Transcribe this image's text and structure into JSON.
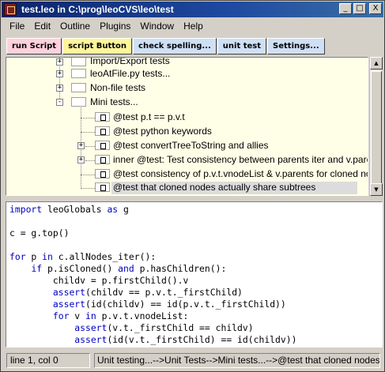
{
  "window": {
    "title": "test.leo in C:\\prog\\leoCVS\\leo\\test",
    "controls": [
      "_",
      "□",
      "X"
    ]
  },
  "menu": [
    "File",
    "Edit",
    "Outline",
    "Plugins",
    "Window",
    "Help"
  ],
  "toolbar": [
    {
      "label": "run Script",
      "color": "#ffd1dc"
    },
    {
      "label": "script Button",
      "color": "#fff59a"
    },
    {
      "label": "check spelling...",
      "color": "#cfe0f5"
    },
    {
      "label": "unit test",
      "color": "#cfe0f5"
    },
    {
      "label": "Settings...",
      "color": "#cfe0f5"
    }
  ],
  "outline": {
    "nodes": [
      {
        "label": "Import/Export tests",
        "expander": "+",
        "icon": "empty"
      },
      {
        "label": "leoAtFile.py tests...",
        "expander": "+",
        "icon": "empty"
      },
      {
        "label": "Non-file tests",
        "expander": "+",
        "icon": "empty"
      },
      {
        "label": "Mini tests...",
        "expander": "-",
        "icon": "empty"
      },
      {
        "label": "@test p.t == p.v.t",
        "expander": "",
        "icon": "dot"
      },
      {
        "label": "@test python keywords",
        "expander": "",
        "icon": "dot"
      },
      {
        "label": "@test convertTreeToString and allies",
        "expander": "+",
        "icon": "dot"
      },
      {
        "label": "inner @test: Test consistency between parents iter and v.parents",
        "expander": "+",
        "icon": "dot"
      },
      {
        "label": "@test consistency of p.v.t.vnodeList & v.parents for cloned nodes",
        "expander": "",
        "icon": "dot"
      },
      {
        "label": "@test that cloned nodes actually share subtrees",
        "expander": "",
        "icon": "dot",
        "selected": true
      }
    ]
  },
  "body": {
    "lines": [
      "import leoGlobals as g",
      "",
      "c = g.top()",
      "",
      "for p in c.allNodes_iter():",
      "    if p.isCloned() and p.hasChildren():",
      "        childv = p.firstChild().v",
      "        assert(childv == p.v.t._firstChild)",
      "        assert(id(childv) == id(p.v.t._firstChild))",
      "        for v in p.v.t.vnodeList:",
      "            assert(v.t._firstChild == childv)",
      "            assert(id(v.t._firstChild) == id(childv))"
    ]
  },
  "status": {
    "position": "line 1, col 0",
    "path": "Unit testing...-->Unit Tests-->Mini tests...-->@test that cloned nodes actually"
  }
}
